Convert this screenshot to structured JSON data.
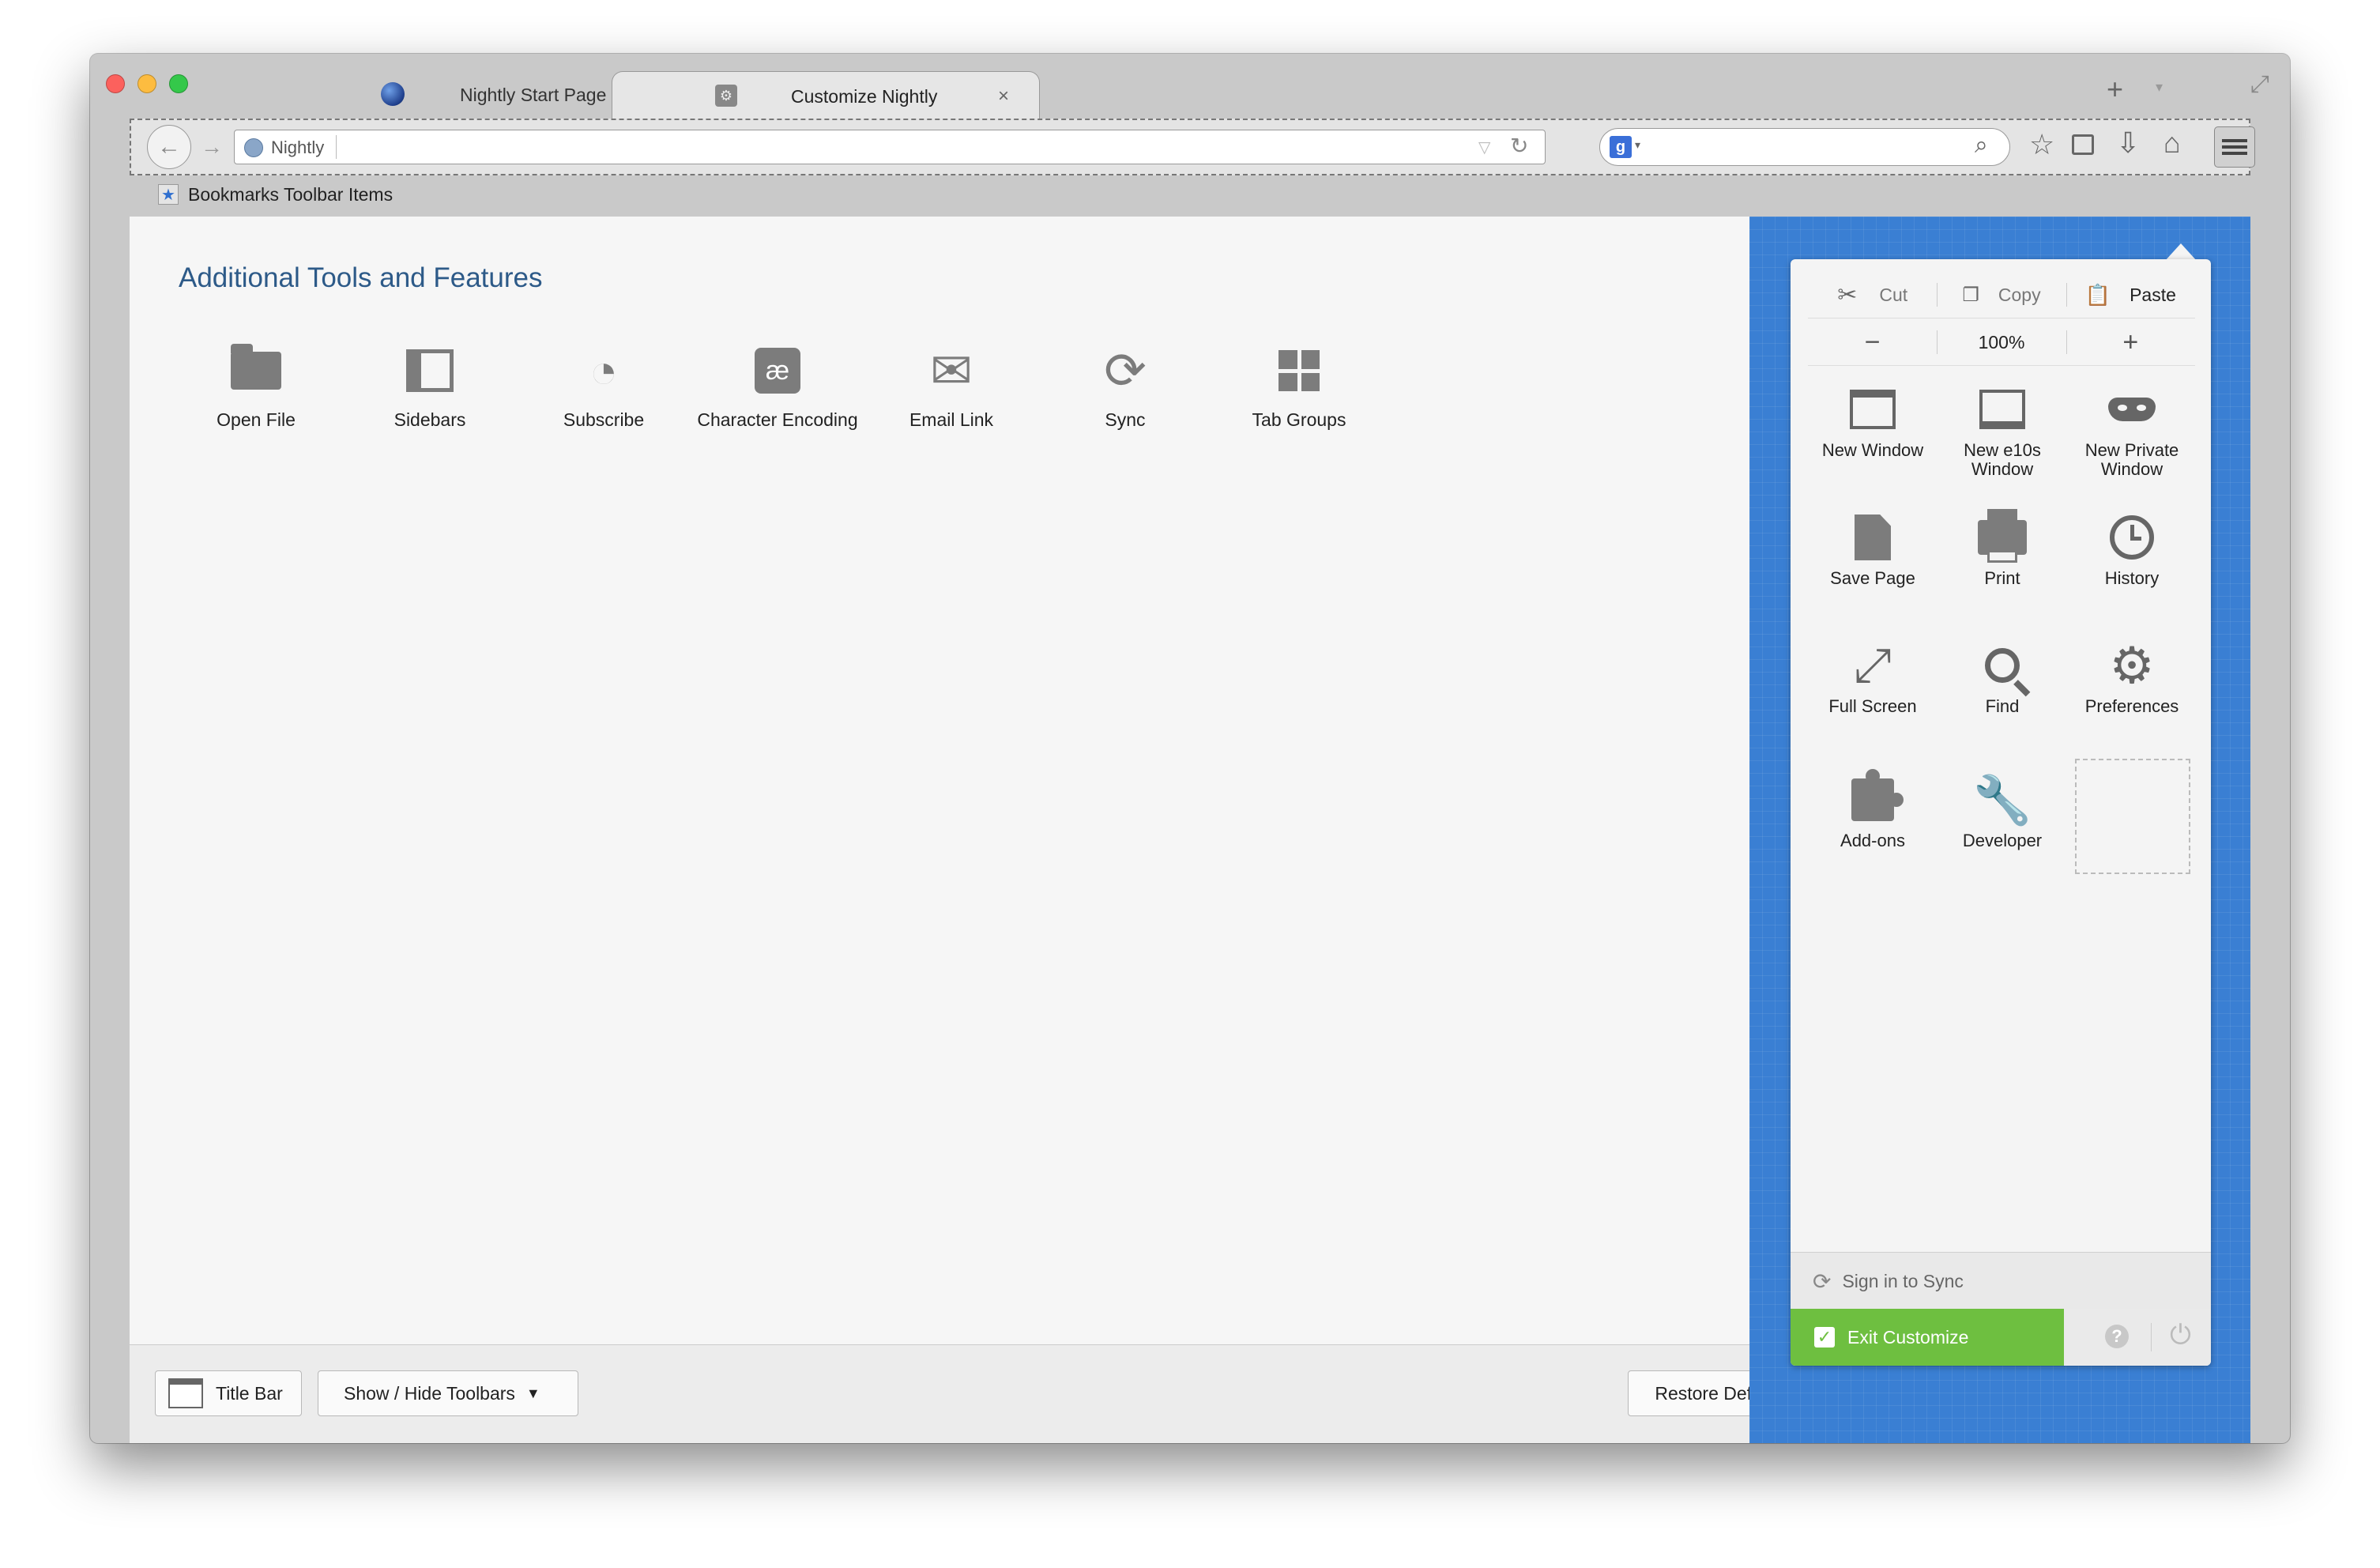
{
  "tabs": {
    "inactive_label": "Nightly Start Page",
    "active_label": "Customize Nightly"
  },
  "navbar": {
    "url_label": "Nightly"
  },
  "bookmarks": {
    "label": "Bookmarks Toolbar Items"
  },
  "palette": {
    "title": "Additional Tools and Features",
    "items": [
      {
        "label": "Open File",
        "icon": "folder-icon"
      },
      {
        "label": "Sidebars",
        "icon": "sidebars-icon"
      },
      {
        "label": "Subscribe",
        "icon": "rss-icon"
      },
      {
        "label": "Character Encoding",
        "icon": "character-encoding-icon"
      },
      {
        "label": "Email Link",
        "icon": "envelope-icon"
      },
      {
        "label": "Sync",
        "icon": "sync-icon"
      },
      {
        "label": "Tab Groups",
        "icon": "tab-groups-icon"
      }
    ]
  },
  "footer": {
    "title_bar": "Title Bar",
    "show_hide": "Show / Hide Toolbars",
    "restore": "Restore Defaults"
  },
  "menu_panel": {
    "cut": "Cut",
    "copy": "Copy",
    "paste": "Paste",
    "zoom_out": "−",
    "zoom_level": "100%",
    "zoom_in": "+",
    "items": [
      {
        "label": "New Window",
        "icon": "new-window-icon"
      },
      {
        "label": "New e10s Window",
        "icon": "e10s-window-icon"
      },
      {
        "label": "New Private Window",
        "icon": "private-mask-icon"
      },
      {
        "label": "Save Page",
        "icon": "save-page-icon"
      },
      {
        "label": "Print",
        "icon": "printer-icon"
      },
      {
        "label": "History",
        "icon": "clock-icon"
      },
      {
        "label": "Full Screen",
        "icon": "fullscreen-icon"
      },
      {
        "label": "Find",
        "icon": "magnifier-icon"
      },
      {
        "label": "Preferences",
        "icon": "gear-icon"
      },
      {
        "label": "Add-ons",
        "icon": "puzzle-icon"
      },
      {
        "label": "Developer",
        "icon": "wrench-icon"
      }
    ],
    "sign_in": "Sign in to Sync",
    "exit_customize": "Exit Customize"
  },
  "colors": {
    "customize_blue": "#3a7fd3",
    "exit_green": "#6ebf40",
    "title_blue": "#2d5a88"
  }
}
